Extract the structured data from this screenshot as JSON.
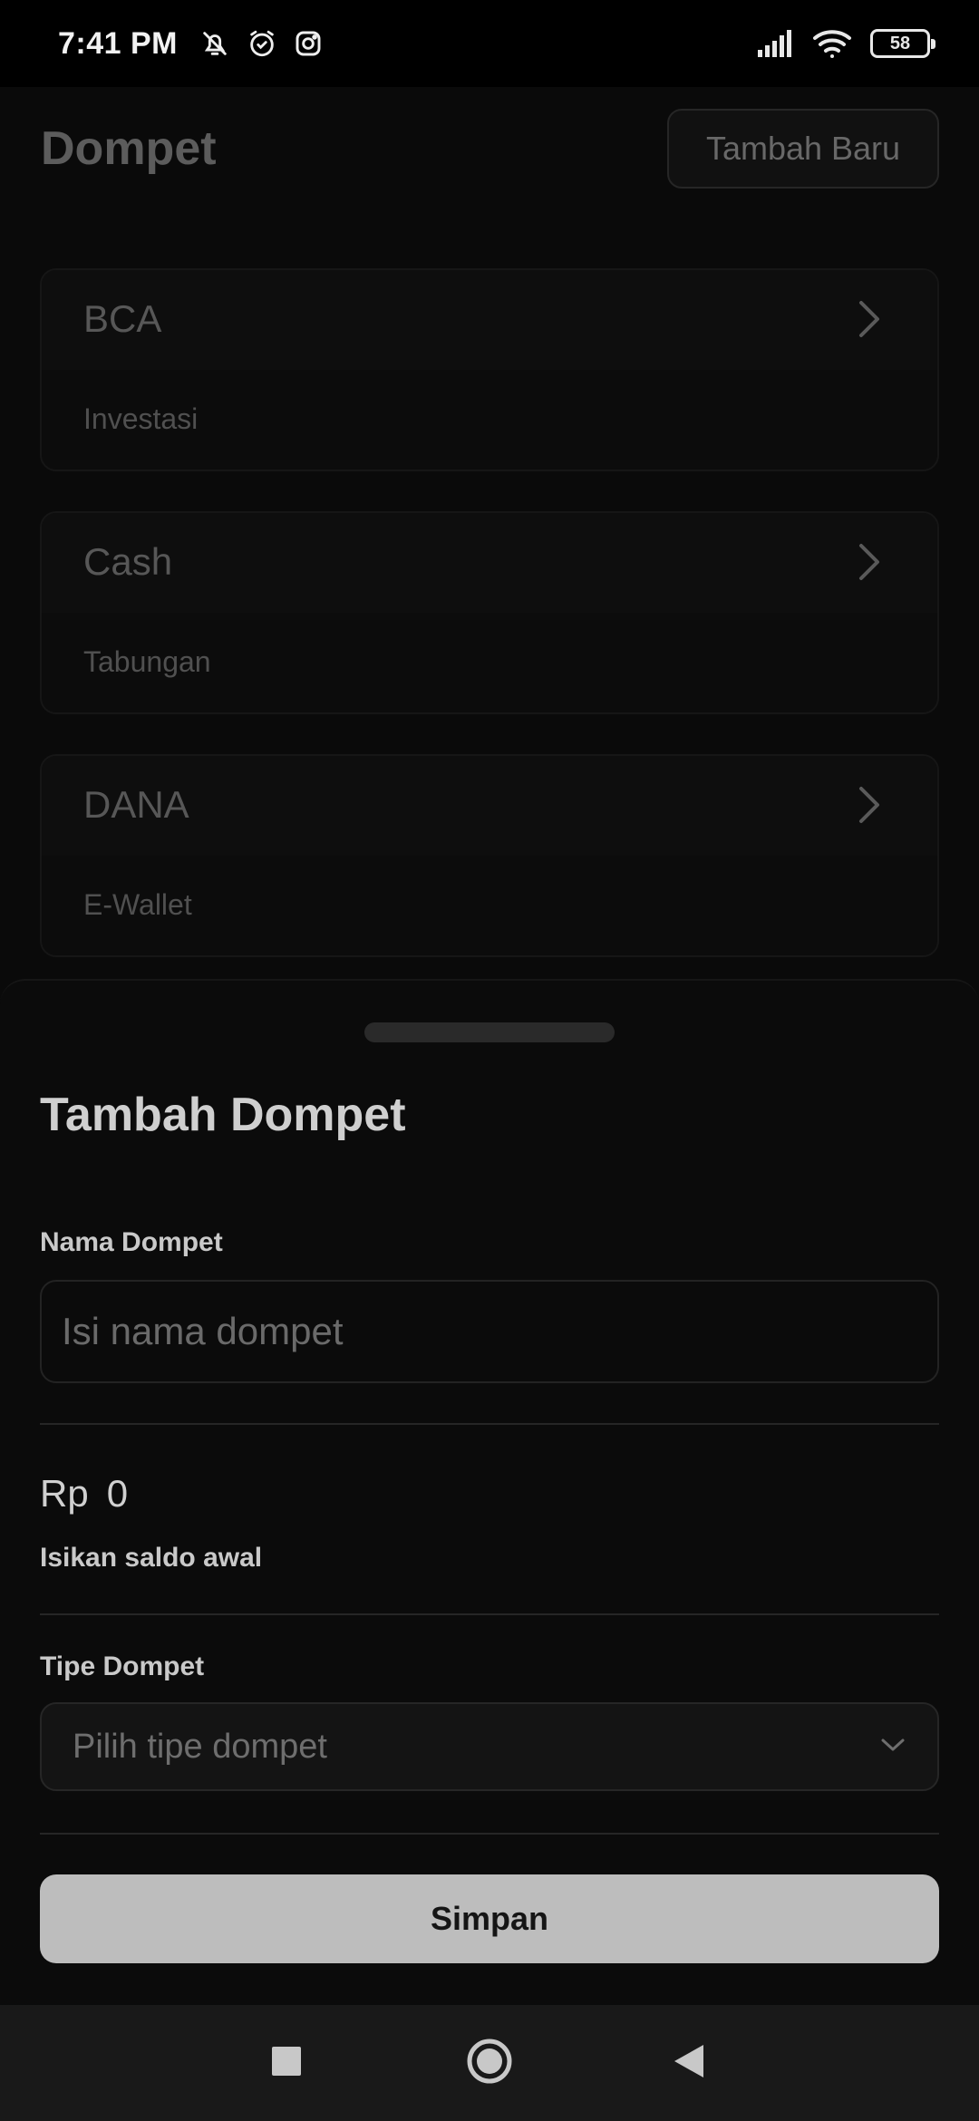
{
  "status_bar": {
    "time": "7:41 PM",
    "battery": "58",
    "icons": [
      "bell-off-icon",
      "alarm-icon",
      "instagram-icon",
      "signal-icon",
      "wifi-icon",
      "battery-icon"
    ]
  },
  "header": {
    "title": "Dompet",
    "add_button_label": "Tambah Baru"
  },
  "wallets": [
    {
      "name": "BCA",
      "type": "Investasi"
    },
    {
      "name": "Cash",
      "type": "Tabungan"
    },
    {
      "name": "DANA",
      "type": "E-Wallet"
    }
  ],
  "sheet": {
    "title": "Tambah Dompet",
    "name_label": "Nama Dompet",
    "name_placeholder": "Isi nama dompet",
    "name_value": "",
    "currency": "Rp",
    "balance_value": "0",
    "balance_hint": "Isikan saldo awal",
    "type_label": "Tipe Dompet",
    "type_placeholder": "Pilih tipe dompet",
    "save_label": "Simpan"
  },
  "nav_bar": {
    "icons": [
      "recents-square-icon",
      "home-circle-icon",
      "back-triangle-icon"
    ]
  },
  "colors": {
    "background": "#0a0a0a",
    "sheet": "#0b0b0b",
    "button": "#bdbdbd"
  }
}
